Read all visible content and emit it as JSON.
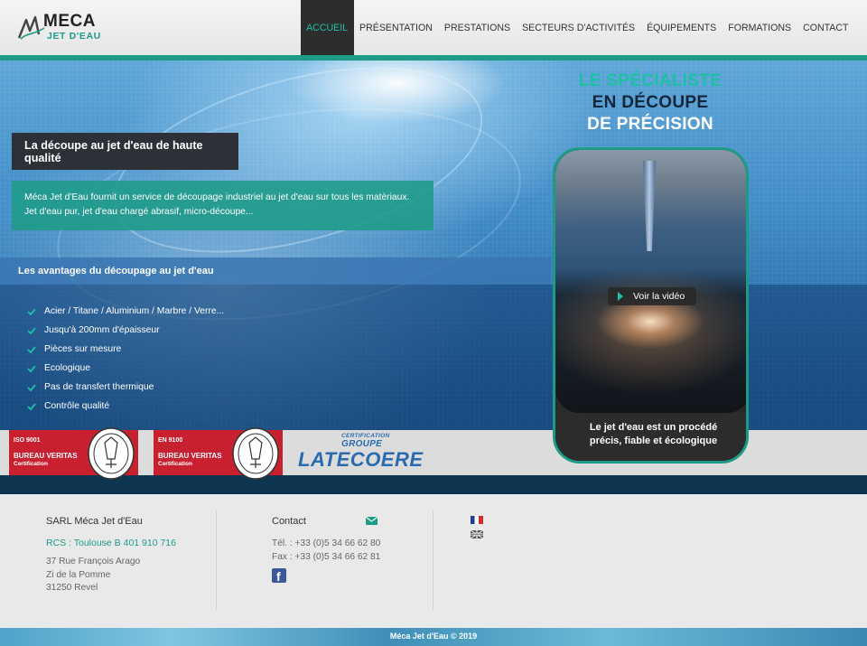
{
  "header": {
    "logo": {
      "line1": "MECA",
      "line2": "JET D'EAU"
    },
    "nav": [
      {
        "label": "ACCUEIL",
        "active": true
      },
      {
        "label": "PRÉSENTATION",
        "active": false
      },
      {
        "label": "PRESTATIONS",
        "active": false
      },
      {
        "label": "SECTEURS D'ACTIVITÉS",
        "active": false
      },
      {
        "label": "ÉQUIPEMENTS",
        "active": false
      },
      {
        "label": "FORMATIONS",
        "active": false
      },
      {
        "label": "CONTACT",
        "active": false
      }
    ]
  },
  "hero": {
    "title": "La découpe au jet d'eau de haute qualité",
    "description_line1": "Méca Jet d'Eau fournit un service de découpage industriel au jet d'eau sur tous les matèriaux.",
    "description_line2": "Jet d'eau pur, jet d'eau chargé abrasif, micro-découpe...",
    "advantages_title": "Les avantages du découpage au jet d'eau",
    "advantages": [
      "Acier / Titane / Aluminium / Marbre / Verre...",
      "Jusqu'à 200mm d'épaisseur",
      "Pièces sur mesure",
      "Ecologique",
      "Pas de transfert thermique",
      "Contrôle qualité"
    ]
  },
  "specialist": {
    "line1": "LE SPÉCIALISTE",
    "line2": "EN DÉCOUPE",
    "line3": "DE PRÉCISION",
    "video_button": "Voir la vidéo",
    "caption_line1": "Le jet d'eau est un procédé",
    "caption_line2": "précis, fiable et écologique"
  },
  "certifications": [
    {
      "code": "ISO 9001",
      "body": "BUREAU VERITAS",
      "sub": "Certification"
    },
    {
      "code": "EN 9100",
      "body": "BUREAU VERITAS",
      "sub": "Certification"
    }
  ],
  "latecoere": {
    "cert": "CERTIFICATION",
    "groupe": "GROUPE",
    "name": "LATECOERE"
  },
  "footer": {
    "company": "SARL Méca Jet d'Eau",
    "rcs": "RCS : Toulouse B 401 910 716",
    "address": [
      "37 Rue François Arago",
      "Zi de la Pomme",
      "31250 Revel"
    ],
    "contact_title": "Contact",
    "tel": "Tél. : +33 (0)5 34 66 62 80",
    "fax": "Fax : +33 (0)5 34 66 62 81",
    "copyright": "Méca Jet d'Eau © 2019"
  },
  "colors": {
    "accent": "#1e9b87",
    "accent_light": "#1ec0a4",
    "dark": "#2e3038",
    "cert_red": "#c8202e",
    "latecoere_blue": "#2a6bb0"
  },
  "icons": {
    "logo_mark": "wave-mark-icon",
    "check": "check-icon",
    "play": "play-icon",
    "mail": "mail-icon",
    "facebook": "facebook-icon",
    "flag_fr": "flag-fr-icon",
    "flag_uk": "flag-uk-icon"
  }
}
